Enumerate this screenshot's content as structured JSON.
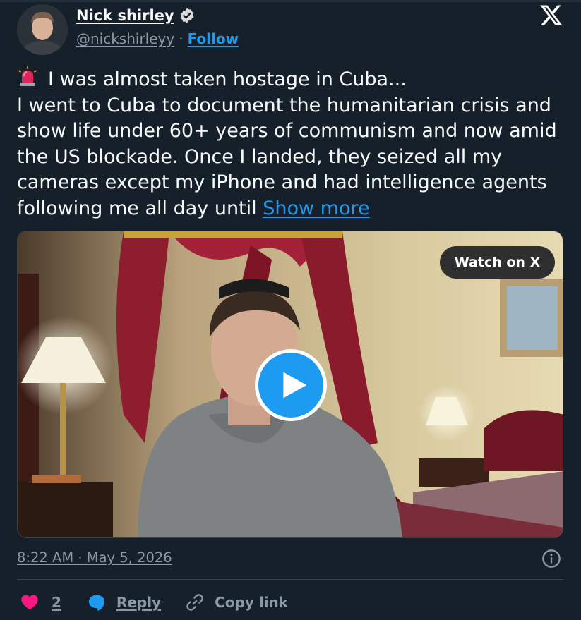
{
  "author": {
    "name": "Nick shirley",
    "handle": "@nickshirleyy",
    "separator": "·",
    "follow_label": "Follow"
  },
  "tweet": {
    "lines": [
      "I was almost taken hostage in Cuba...",
      "I went to Cuba to document the humanitarian crisis and",
      "show life under 60+ years of communism and now amid",
      "the US blockade. Once I landed, they seized all my",
      "cameras except my iPhone and had intelligence agents",
      "following me all day until"
    ],
    "show_more_label": "Show more",
    "leading_emoji": "siren-icon"
  },
  "media": {
    "watch_label": "Watch on X",
    "play_icon": "play-icon"
  },
  "timestamp": "8:22 AM · May 5, 2026",
  "actions": {
    "like_count": "2",
    "reply_label": "Reply",
    "copy_label": "Copy link"
  },
  "colors": {
    "background": "#15202b",
    "accent": "#1d9bf0",
    "like": "#f91880",
    "muted": "#8b98a5"
  }
}
